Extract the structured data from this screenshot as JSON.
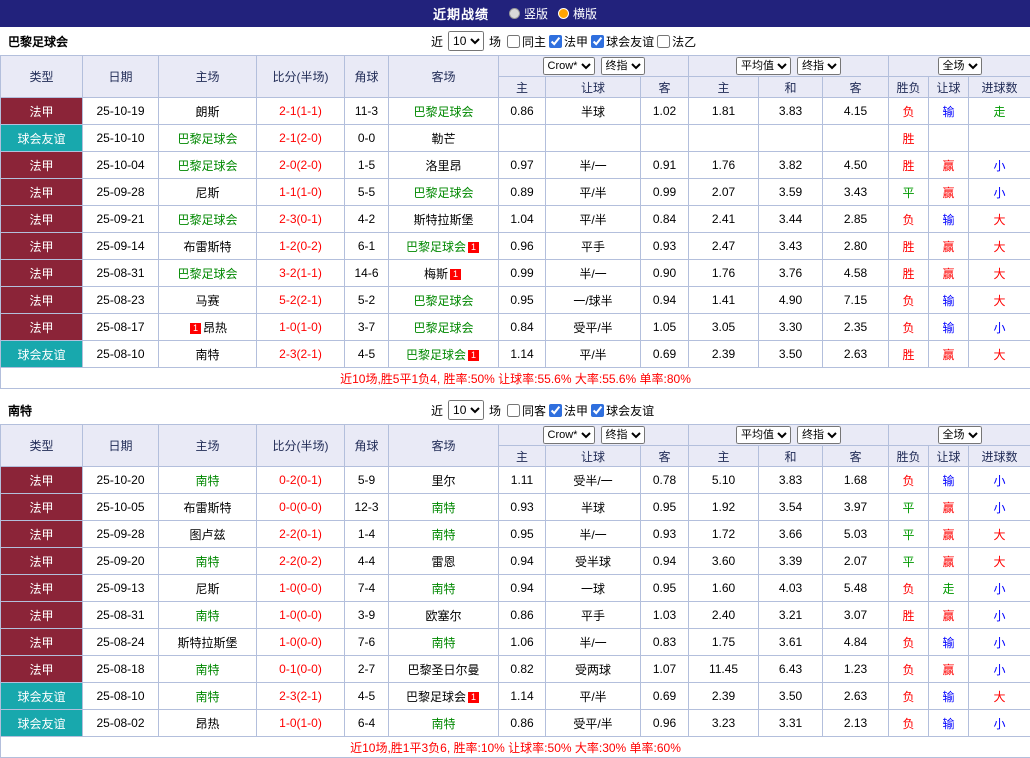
{
  "topbar": {
    "title": "近期战绩",
    "radios": [
      {
        "label": "竖版",
        "selected": false
      },
      {
        "label": "横版",
        "selected": true
      }
    ]
  },
  "palette": {
    "topbar_bg": "#22227c",
    "league_ligue1_bg": "#8b2438",
    "league_friendly_bg": "#18a8ad",
    "highlight_team": "#008800",
    "score_text": "#ff0000",
    "result_red": "#ff0000",
    "result_blue": "#0000ff",
    "result_green": "#009900",
    "header_bg": "#e9eaf6"
  },
  "filter_words": {
    "near": "近",
    "matches": "场"
  },
  "headers": {
    "left": [
      "类型",
      "日期",
      "主场",
      "比分(半场)",
      "角球",
      "客场"
    ],
    "group1_selects": [
      "Crow*",
      "终指"
    ],
    "group2_selects": [
      "平均值",
      "终指"
    ],
    "group3_select": "全场",
    "group1_cols": [
      "主",
      "让球",
      "客"
    ],
    "group2_cols": [
      "主",
      "和",
      "客"
    ],
    "group3_cols": [
      "胜负",
      "让球",
      "进球数"
    ]
  },
  "sections": [
    {
      "team": "巴黎足球会",
      "count": "10",
      "checks": [
        {
          "label": "同主",
          "checked": false
        },
        {
          "label": "法甲",
          "checked": true
        },
        {
          "label": "球会友谊",
          "checked": true
        },
        {
          "label": "法乙",
          "checked": false
        }
      ],
      "rows": [
        {
          "league": {
            "text": "法甲",
            "cls": "l1"
          },
          "date": "25-10-19",
          "home": {
            "name": "朗斯"
          },
          "score": "2-1(1-1)",
          "corner": "11-3",
          "away": {
            "name": "巴黎足球会",
            "hl": true
          },
          "odds": [
            "0.86",
            "半球",
            "1.02"
          ],
          "avg": [
            "1.81",
            "3.83",
            "4.15"
          ],
          "res": [
            [
              "负",
              "red"
            ],
            [
              "输",
              "blue"
            ],
            [
              "走",
              "green"
            ]
          ]
        },
        {
          "league": {
            "text": "球会友谊",
            "cls": "fr"
          },
          "date": "25-10-10",
          "home": {
            "name": "巴黎足球会",
            "hl": true
          },
          "score": "2-1(2-0)",
          "corner": "0-0",
          "away": {
            "name": "勒芒"
          },
          "odds": [
            "",
            "",
            ""
          ],
          "avg": [
            "",
            "",
            ""
          ],
          "res": [
            [
              "胜",
              "red"
            ],
            [
              "",
              ""
            ],
            [
              "",
              ""
            ]
          ]
        },
        {
          "league": {
            "text": "法甲",
            "cls": "l1"
          },
          "date": "25-10-04",
          "home": {
            "name": "巴黎足球会",
            "hl": true
          },
          "score": "2-0(2-0)",
          "corner": "1-5",
          "away": {
            "name": "洛里昂"
          },
          "odds": [
            "0.97",
            "半/一",
            "0.91"
          ],
          "avg": [
            "1.76",
            "3.82",
            "4.50"
          ],
          "res": [
            [
              "胜",
              "red"
            ],
            [
              "赢",
              "red"
            ],
            [
              "小",
              "blue"
            ]
          ]
        },
        {
          "league": {
            "text": "法甲",
            "cls": "l1"
          },
          "date": "25-09-28",
          "home": {
            "name": "尼斯"
          },
          "score": "1-1(1-0)",
          "corner": "5-5",
          "away": {
            "name": "巴黎足球会",
            "hl": true
          },
          "odds": [
            "0.89",
            "平/半",
            "0.99"
          ],
          "avg": [
            "2.07",
            "3.59",
            "3.43"
          ],
          "res": [
            [
              "平",
              "green"
            ],
            [
              "赢",
              "red"
            ],
            [
              "小",
              "blue"
            ]
          ]
        },
        {
          "league": {
            "text": "法甲",
            "cls": "l1"
          },
          "date": "25-09-21",
          "home": {
            "name": "巴黎足球会",
            "hl": true
          },
          "score": "2-3(0-1)",
          "corner": "4-2",
          "away": {
            "name": "斯特拉斯堡"
          },
          "odds": [
            "1.04",
            "平/半",
            "0.84"
          ],
          "avg": [
            "2.41",
            "3.44",
            "2.85"
          ],
          "res": [
            [
              "负",
              "red"
            ],
            [
              "输",
              "blue"
            ],
            [
              "大",
              "red"
            ]
          ]
        },
        {
          "league": {
            "text": "法甲",
            "cls": "l1"
          },
          "date": "25-09-14",
          "home": {
            "name": "布雷斯特"
          },
          "score": "1-2(0-2)",
          "corner": "6-1",
          "away": {
            "name": "巴黎足球会",
            "hl": true,
            "badge": "1",
            "badge_side": "right"
          },
          "odds": [
            "0.96",
            "平手",
            "0.93"
          ],
          "avg": [
            "2.47",
            "3.43",
            "2.80"
          ],
          "res": [
            [
              "胜",
              "red"
            ],
            [
              "赢",
              "red"
            ],
            [
              "大",
              "red"
            ]
          ]
        },
        {
          "league": {
            "text": "法甲",
            "cls": "l1"
          },
          "date": "25-08-31",
          "home": {
            "name": "巴黎足球会",
            "hl": true
          },
          "score": "3-2(1-1)",
          "corner": "14-6",
          "away": {
            "name": "梅斯",
            "badge": "1",
            "badge_side": "right"
          },
          "odds": [
            "0.99",
            "半/一",
            "0.90"
          ],
          "avg": [
            "1.76",
            "3.76",
            "4.58"
          ],
          "res": [
            [
              "胜",
              "red"
            ],
            [
              "赢",
              "red"
            ],
            [
              "大",
              "red"
            ]
          ]
        },
        {
          "league": {
            "text": "法甲",
            "cls": "l1"
          },
          "date": "25-08-23",
          "home": {
            "name": "马赛"
          },
          "score": "5-2(2-1)",
          "corner": "5-2",
          "away": {
            "name": "巴黎足球会",
            "hl": true
          },
          "odds": [
            "0.95",
            "一/球半",
            "0.94"
          ],
          "avg": [
            "1.41",
            "4.90",
            "7.15"
          ],
          "res": [
            [
              "负",
              "red"
            ],
            [
              "输",
              "blue"
            ],
            [
              "大",
              "red"
            ]
          ]
        },
        {
          "league": {
            "text": "法甲",
            "cls": "l1"
          },
          "date": "25-08-17",
          "home": {
            "name": "昂热",
            "badge": "1",
            "badge_side": "left"
          },
          "score": "1-0(1-0)",
          "corner": "3-7",
          "away": {
            "name": "巴黎足球会",
            "hl": true
          },
          "odds": [
            "0.84",
            "受平/半",
            "1.05"
          ],
          "avg": [
            "3.05",
            "3.30",
            "2.35"
          ],
          "res": [
            [
              "负",
              "red"
            ],
            [
              "输",
              "blue"
            ],
            [
              "小",
              "blue"
            ]
          ]
        },
        {
          "league": {
            "text": "球会友谊",
            "cls": "fr"
          },
          "date": "25-08-10",
          "home": {
            "name": "南特"
          },
          "score": "2-3(2-1)",
          "corner": "4-5",
          "away": {
            "name": "巴黎足球会",
            "hl": true,
            "badge": "1",
            "badge_side": "right"
          },
          "odds": [
            "1.14",
            "平/半",
            "0.69"
          ],
          "avg": [
            "2.39",
            "3.50",
            "2.63"
          ],
          "res": [
            [
              "胜",
              "red"
            ],
            [
              "赢",
              "red"
            ],
            [
              "大",
              "red"
            ]
          ]
        }
      ],
      "summary": "近10场,胜5平1负4, 胜率:50% 让球率:55.6% 大率:55.6% 单率:80%"
    },
    {
      "team": "南特",
      "count": "10",
      "checks": [
        {
          "label": "同客",
          "checked": false
        },
        {
          "label": "法甲",
          "checked": true
        },
        {
          "label": "球会友谊",
          "checked": true
        }
      ],
      "rows": [
        {
          "league": {
            "text": "法甲",
            "cls": "l1"
          },
          "date": "25-10-20",
          "home": {
            "name": "南特",
            "hl": true
          },
          "score": "0-2(0-1)",
          "corner": "5-9",
          "away": {
            "name": "里尔"
          },
          "odds": [
            "1.11",
            "受半/一",
            "0.78"
          ],
          "avg": [
            "5.10",
            "3.83",
            "1.68"
          ],
          "res": [
            [
              "负",
              "red"
            ],
            [
              "输",
              "blue"
            ],
            [
              "小",
              "blue"
            ]
          ]
        },
        {
          "league": {
            "text": "法甲",
            "cls": "l1"
          },
          "date": "25-10-05",
          "home": {
            "name": "布雷斯特"
          },
          "score": "0-0(0-0)",
          "corner": "12-3",
          "away": {
            "name": "南特",
            "hl": true
          },
          "odds": [
            "0.93",
            "半球",
            "0.95"
          ],
          "avg": [
            "1.92",
            "3.54",
            "3.97"
          ],
          "res": [
            [
              "平",
              "green"
            ],
            [
              "赢",
              "red"
            ],
            [
              "小",
              "blue"
            ]
          ]
        },
        {
          "league": {
            "text": "法甲",
            "cls": "l1"
          },
          "date": "25-09-28",
          "home": {
            "name": "图卢兹"
          },
          "score": "2-2(0-1)",
          "corner": "1-4",
          "away": {
            "name": "南特",
            "hl": true
          },
          "odds": [
            "0.95",
            "半/一",
            "0.93"
          ],
          "avg": [
            "1.72",
            "3.66",
            "5.03"
          ],
          "res": [
            [
              "平",
              "green"
            ],
            [
              "赢",
              "red"
            ],
            [
              "大",
              "red"
            ]
          ]
        },
        {
          "league": {
            "text": "法甲",
            "cls": "l1"
          },
          "date": "25-09-20",
          "home": {
            "name": "南特",
            "hl": true
          },
          "score": "2-2(0-2)",
          "corner": "4-4",
          "away": {
            "name": "雷恩"
          },
          "odds": [
            "0.94",
            "受半球",
            "0.94"
          ],
          "avg": [
            "3.60",
            "3.39",
            "2.07"
          ],
          "res": [
            [
              "平",
              "green"
            ],
            [
              "赢",
              "red"
            ],
            [
              "大",
              "red"
            ]
          ]
        },
        {
          "league": {
            "text": "法甲",
            "cls": "l1"
          },
          "date": "25-09-13",
          "home": {
            "name": "尼斯"
          },
          "score": "1-0(0-0)",
          "corner": "7-4",
          "away": {
            "name": "南特",
            "hl": true
          },
          "odds": [
            "0.94",
            "一球",
            "0.95"
          ],
          "avg": [
            "1.60",
            "4.03",
            "5.48"
          ],
          "res": [
            [
              "负",
              "red"
            ],
            [
              "走",
              "green"
            ],
            [
              "小",
              "blue"
            ]
          ]
        },
        {
          "league": {
            "text": "法甲",
            "cls": "l1"
          },
          "date": "25-08-31",
          "home": {
            "name": "南特",
            "hl": true
          },
          "score": "1-0(0-0)",
          "corner": "3-9",
          "away": {
            "name": "欧塞尔"
          },
          "odds": [
            "0.86",
            "平手",
            "1.03"
          ],
          "avg": [
            "2.40",
            "3.21",
            "3.07"
          ],
          "res": [
            [
              "胜",
              "red"
            ],
            [
              "赢",
              "red"
            ],
            [
              "小",
              "blue"
            ]
          ]
        },
        {
          "league": {
            "text": "法甲",
            "cls": "l1"
          },
          "date": "25-08-24",
          "home": {
            "name": "斯特拉斯堡"
          },
          "score": "1-0(0-0)",
          "corner": "7-6",
          "away": {
            "name": "南特",
            "hl": true
          },
          "odds": [
            "1.06",
            "半/一",
            "0.83"
          ],
          "avg": [
            "1.75",
            "3.61",
            "4.84"
          ],
          "res": [
            [
              "负",
              "red"
            ],
            [
              "输",
              "blue"
            ],
            [
              "小",
              "blue"
            ]
          ]
        },
        {
          "league": {
            "text": "法甲",
            "cls": "l1"
          },
          "date": "25-08-18",
          "home": {
            "name": "南特",
            "hl": true
          },
          "score": "0-1(0-0)",
          "corner": "2-7",
          "away": {
            "name": "巴黎圣日尔曼"
          },
          "odds": [
            "0.82",
            "受两球",
            "1.07"
          ],
          "avg": [
            "11.45",
            "6.43",
            "1.23"
          ],
          "res": [
            [
              "负",
              "red"
            ],
            [
              "赢",
              "red"
            ],
            [
              "小",
              "blue"
            ]
          ]
        },
        {
          "league": {
            "text": "球会友谊",
            "cls": "fr"
          },
          "date": "25-08-10",
          "home": {
            "name": "南特",
            "hl": true
          },
          "score": "2-3(2-1)",
          "corner": "4-5",
          "away": {
            "name": "巴黎足球会",
            "badge": "1",
            "badge_side": "right"
          },
          "odds": [
            "1.14",
            "平/半",
            "0.69"
          ],
          "avg": [
            "2.39",
            "3.50",
            "2.63"
          ],
          "res": [
            [
              "负",
              "red"
            ],
            [
              "输",
              "blue"
            ],
            [
              "大",
              "red"
            ]
          ]
        },
        {
          "league": {
            "text": "球会友谊",
            "cls": "fr"
          },
          "date": "25-08-02",
          "home": {
            "name": "昂热"
          },
          "score": "1-0(1-0)",
          "corner": "6-4",
          "away": {
            "name": "南特",
            "hl": true
          },
          "odds": [
            "0.86",
            "受平/半",
            "0.96"
          ],
          "avg": [
            "3.23",
            "3.31",
            "2.13"
          ],
          "res": [
            [
              "负",
              "red"
            ],
            [
              "输",
              "blue"
            ],
            [
              "小",
              "blue"
            ]
          ]
        }
      ],
      "summary": "近10场,胜1平3负6, 胜率:10% 让球率:50% 大率:30% 单率:60%"
    }
  ]
}
